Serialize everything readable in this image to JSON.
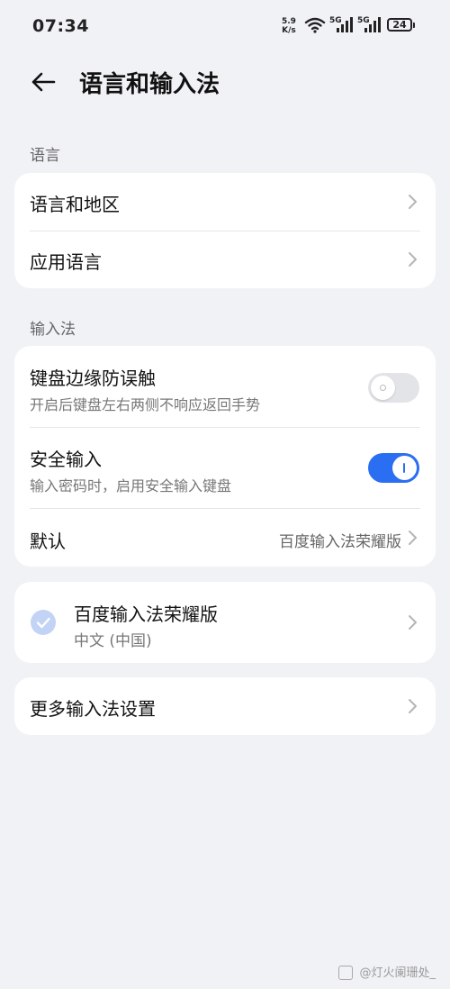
{
  "status_bar": {
    "time": "07:34",
    "net_speed_value": "5.9",
    "net_speed_unit": "K/s",
    "signal1_label": "5G",
    "signal2_label": "5G",
    "battery": "24"
  },
  "header": {
    "title": "语言和输入法",
    "back_icon": "arrow-left-icon"
  },
  "sections": {
    "language_label": "语言",
    "input_label": "输入法"
  },
  "language_card": {
    "region_label": "语言和地区",
    "app_language_label": "应用语言"
  },
  "input_card": {
    "edge_touch": {
      "title": "键盘边缘防误触",
      "subtitle": "开启后键盘左右两侧不响应返回手势",
      "enabled": false
    },
    "secure_input": {
      "title": "安全输入",
      "subtitle": "输入密码时，启用安全输入键盘",
      "enabled": true
    },
    "default": {
      "title": "默认",
      "value": "百度输入法荣耀版"
    }
  },
  "ime_card": {
    "name": "百度输入法荣耀版",
    "locale": "中文 (中国)",
    "selected": true
  },
  "more_card": {
    "label": "更多输入法设置"
  },
  "watermark": {
    "text": "@灯火阑珊处_"
  },
  "colors": {
    "background": "#f1f2f6",
    "accent": "#2a6ef2",
    "check_bg": "#c3d3f6"
  }
}
